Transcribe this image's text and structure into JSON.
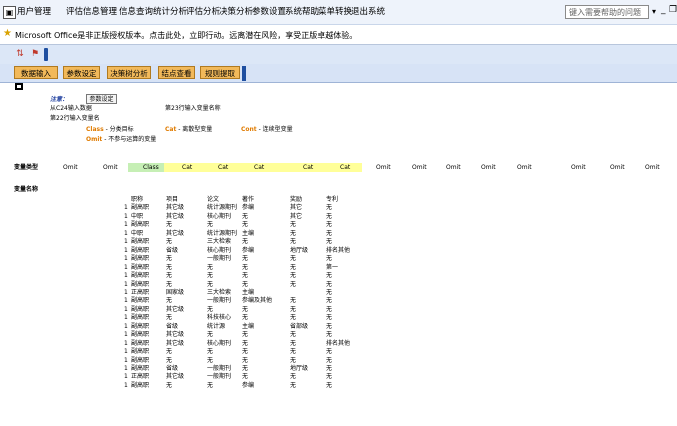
{
  "menubar": {
    "items": [
      "用户管理",
      "评估信息管理",
      "信息查询",
      "统计分析",
      "评估分析",
      "决策分析",
      "参数设置",
      "系统帮助",
      "菜单转换",
      "退出系统"
    ],
    "help_placeholder": "键入需要帮助的问题",
    "help_arrow": "▾",
    "min": "_",
    "restore": "❐"
  },
  "infobar": {
    "text": "Microsoft Office是非正版授权版本。点击此处，立即行动。远离潜在风险，享受正版卓越体验。"
  },
  "ribbon": {
    "buttons": [
      "数据输入",
      "参数设定",
      "决策树分析",
      "结点查看",
      "规则提取"
    ]
  },
  "sheet": {
    "note_label": "注意：",
    "tooltip": "参数设定",
    "line1": "从C24输入数据",
    "line1b": "第23行输入变量名称",
    "line2": "第22行输入变量名",
    "class_key": "Class",
    "class_desc": " - 分类目标",
    "cat_key": "Cat",
    "cat_desc": " - 离散型变量",
    "cont_key": "Cont",
    "cont_desc": " - 连续型变量",
    "omit_key": "Omit",
    "omit_desc": " - 不参与运算的变量",
    "var_type_label": "变量类型",
    "var_name_label": "变量名称",
    "type_row": [
      "Omit",
      "Omit",
      "Class",
      "Cat",
      "Cat",
      "Cat",
      "Cat",
      "Cat",
      "Omit",
      "Omit",
      "Omit",
      "Omit",
      "Omit",
      "Omit",
      "Omit",
      "Omit"
    ],
    "headers": [
      "职称",
      "项目",
      "论文",
      "著作",
      "奖励",
      "专利"
    ],
    "rows": [
      [
        "1",
        "副高职",
        "其它级",
        "统计源期刊",
        "参编",
        "其它",
        "无"
      ],
      [
        "1",
        "中职",
        "其它级",
        "核心期刊",
        "无",
        "其它",
        "无"
      ],
      [
        "1",
        "副高职",
        "无",
        "无",
        "无",
        "无",
        "无"
      ],
      [
        "1",
        "中职",
        "其它级",
        "统计源期刊",
        "主编",
        "无",
        "无"
      ],
      [
        "1",
        "副高职",
        "无",
        "三大检索",
        "无",
        "无",
        "无"
      ],
      [
        "1",
        "副高职",
        "省级",
        "核心期刊",
        "参编",
        "地厅级",
        "排名其他"
      ],
      [
        "1",
        "副高职",
        "无",
        "一般期刊",
        "无",
        "无",
        "无"
      ],
      [
        "1",
        "副高职",
        "无",
        "无",
        "无",
        "无",
        "第一"
      ],
      [
        "1",
        "副高职",
        "无",
        "无",
        "无",
        "无",
        "无"
      ],
      [
        "1",
        "副高职",
        "无",
        "无",
        "无",
        "无",
        "无"
      ],
      [
        "1",
        "正高职",
        "国家级",
        "三大检索",
        "主编",
        "",
        "无"
      ],
      [
        "1",
        "副高职",
        "无",
        "一般期刊",
        "参编及其他",
        "无",
        "无"
      ],
      [
        "1",
        "副高职",
        "其它级",
        "无",
        "无",
        "无",
        "无"
      ],
      [
        "1",
        "副高职",
        "无",
        "科技核心",
        "无",
        "无",
        "无"
      ],
      [
        "1",
        "副高职",
        "省级",
        "统计源",
        "主编",
        "省部级",
        "无"
      ],
      [
        "1",
        "副高职",
        "其它级",
        "无",
        "无",
        "无",
        "无"
      ],
      [
        "1",
        "副高职",
        "其它级",
        "核心期刊",
        "无",
        "无",
        "排名其他"
      ],
      [
        "1",
        "副高职",
        "无",
        "无",
        "无",
        "无",
        "无"
      ],
      [
        "1",
        "副高职",
        "无",
        "无",
        "无",
        "无",
        "无"
      ],
      [
        "1",
        "副高职",
        "省级",
        "一般期刊",
        "无",
        "地厅级",
        "无"
      ],
      [
        "1",
        "正高职",
        "其它级",
        "一般期刊",
        "无",
        "无",
        "无"
      ],
      [
        "1",
        "副高职",
        "无",
        "无",
        "参编",
        "无",
        "无"
      ]
    ]
  }
}
